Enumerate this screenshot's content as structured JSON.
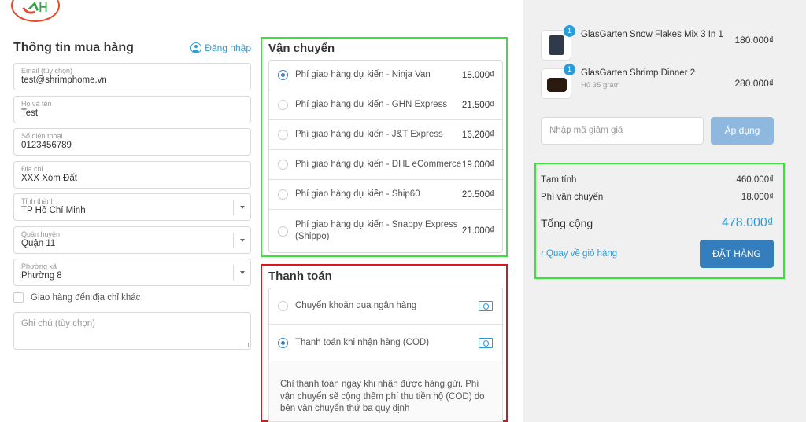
{
  "logo": {
    "icon": "shrimphome-logo"
  },
  "customer": {
    "title": "Thông tin mua hàng",
    "login_label": "Đăng nhập",
    "fields": [
      {
        "label": "Email (tùy chọn)",
        "value": "test@shrimphome.vn"
      },
      {
        "label": "Họ và tên",
        "value": "Test"
      },
      {
        "label": "Số điện thoại",
        "value": "0123456789"
      },
      {
        "label": "Địa chỉ",
        "value": "XXX Xóm Đất"
      },
      {
        "label": "Tỉnh thành",
        "value": "TP Hồ Chí Minh"
      },
      {
        "label": "Quận huyện",
        "value": "Quận 11"
      },
      {
        "label": "Phường xã",
        "value": "Phường 8"
      }
    ],
    "ship_other_label": "Giao hàng đến địa chỉ khác",
    "note_placeholder": "Ghi chú (tùy chọn)"
  },
  "shipping": {
    "title": "Vận chuyển",
    "selected_index": 0,
    "options": [
      {
        "label": "Phí giao hàng dự kiến - Ninja Van",
        "price": "18.000₫"
      },
      {
        "label": "Phí giao hàng dự kiến - GHN Express",
        "price": "21.500₫"
      },
      {
        "label": "Phí giao hàng dự kiến - J&T Express",
        "price": "16.200₫"
      },
      {
        "label": "Phí giao hàng dự kiến - DHL eCommerce",
        "price": "19.000₫"
      },
      {
        "label": "Phí giao hàng dự kiến - Ship60",
        "price": "20.500₫"
      },
      {
        "label": "Phí giao hàng dự kiến - Snappy Express (Shippo)",
        "price": "21.000₫"
      }
    ]
  },
  "payment": {
    "title": "Thanh toán",
    "selected_index": 1,
    "options": [
      {
        "label": "Chuyển khoản qua ngân hàng",
        "icon": "money-icon"
      },
      {
        "label": "Thanh toán khi nhận hàng (COD)",
        "icon": "money-icon"
      }
    ],
    "description": "Chỉ thanh toán ngay khi nhận được hàng gửi. Phí vận chuyển sẽ cộng thêm phí thu tiền hộ (COD) do bên vận chuyển thứ ba quy định"
  },
  "cart": {
    "items": [
      {
        "qty": "1",
        "name": "GlasGarten Snow Flakes Mix 3 In 1",
        "variant": "",
        "price": "180.000₫"
      },
      {
        "qty": "1",
        "name": "GlasGarten Shrimp Dinner 2",
        "variant": "Hủ 35 gram",
        "price": "280.000₫"
      }
    ],
    "coupon_placeholder": "Nhập mã giảm giá",
    "coupon_button": "Áp dụng",
    "subtotal_label": "Tạm tính",
    "subtotal_value": "460.000₫",
    "shipping_label": "Phí vận chuyển",
    "shipping_value": "18.000₫",
    "total_label": "Tổng cộng",
    "total_value": "478.000₫",
    "back_label": "Quay về giỏ hàng",
    "order_button": "ĐẶT HÀNG"
  },
  "colors": {
    "accent": "#2a9dd8",
    "button_primary": "#357ebd",
    "highlight_green": "#37e337",
    "highlight_red": "#e0151a"
  }
}
